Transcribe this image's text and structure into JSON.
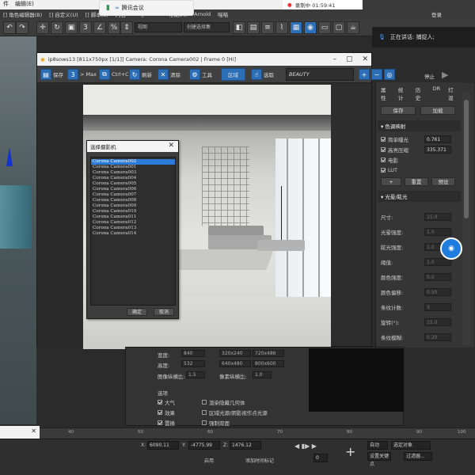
{
  "top_strip": {
    "left_items": [
      "件",
      "编辑(E)"
    ],
    "meeting_label": "腾讯会议",
    "recording_label": "录制中 01:59:41",
    "right_label": "登录"
  },
  "menu": [
    "[] 角色编辑器(B)",
    "[] 自定义(U)",
    "[] 脚本(S)",
    "内容",
    "Megascans",
    "帮助(H)",
    "Arnold",
    "喵喵"
  ],
  "toolbar": {
    "view_select": "视图",
    "selection_set": "创建选择集"
  },
  "speaker": {
    "label": "正在讲话: 捕捉人;"
  },
  "render_window": {
    "title": "ip8sows13 [811x750px [1/1]] Camera: Corona Camera002 | Frame 0 [Hi]",
    "toolbar": {
      "save": "保存",
      "max": "> Max",
      "copy": "Ctrl+C",
      "refresh": "刷新",
      "clear": "清除",
      "tools": "工具",
      "region": "区域",
      "select": "选取",
      "pass": "BEAUTY",
      "stop": "停止"
    },
    "side": {
      "tabs": [
        "属性",
        "统计",
        "历史",
        "DR",
        "灯混"
      ],
      "save_button": "保存",
      "load_button": "加载",
      "tone_section": "色调映射",
      "tone_params": [
        {
          "label": "简单曝光",
          "value": "0.761",
          "checked": true
        },
        {
          "label": "高亮压缩",
          "value": "335.371",
          "checked": true
        },
        {
          "label": "电影",
          "value": "",
          "checked": true
        },
        {
          "label": "LUT",
          "value": "",
          "checked": true
        }
      ],
      "plus": "+",
      "reset_button": "重置",
      "preset_button": "预设",
      "bloom_section": "光晕/眩光",
      "bloom_params": [
        {
          "label": "尺寸:",
          "value": "15.0"
        },
        {
          "label": "光晕强度:",
          "value": "1.0"
        },
        {
          "label": "眩光强度:",
          "value": "1.0"
        },
        {
          "label": "阈值:",
          "value": "1.0"
        },
        {
          "label": "颜色强度:",
          "value": "0.0"
        },
        {
          "label": "颜色偏移:",
          "value": "0.50"
        },
        {
          "label": "条纹计数:",
          "value": "3"
        },
        {
          "label": "旋转(°):",
          "value": "15.0"
        },
        {
          "label": "条纹模糊:",
          "value": "0.20"
        }
      ]
    }
  },
  "camera_dialog": {
    "title": "选择摄影机",
    "close": "✕",
    "cameras": [
      "Corona Camera002",
      "Corona Camera001",
      "Corona Camera003",
      "Corona Camera004",
      "Corona Camera005",
      "Corona Camera006",
      "Corona Camera007",
      "Corona Camera008",
      "Corona Camera009",
      "Corona Camera010",
      "Corona Camera011",
      "Corona Camera012",
      "Corona Camera013",
      "Corona Camera014"
    ],
    "selected_index": 0,
    "ok": "确定",
    "cancel": "取消"
  },
  "render_setup": {
    "width_label": "宽度:",
    "width_value": "840",
    "height_label": "高度:",
    "height_value": "532",
    "presets": [
      "320x240",
      "720x486",
      "640x480",
      "800x600"
    ],
    "aspect_label": "图像纵横比:",
    "aspect_value": "1.5",
    "pixel_aspect_label": "像素纵横比:",
    "pixel_aspect_value": "1.0",
    "options_label": "选项",
    "options": [
      {
        "label": "大气",
        "checked": true
      },
      {
        "label": "效果",
        "checked": true
      },
      {
        "label": "置换",
        "checked": true
      }
    ],
    "options_right": [
      "渲染隐藏几何体",
      "区域光源/阴影视作点光源",
      "强制双面"
    ]
  },
  "timeline": {
    "ticks": [
      "40",
      "50",
      "60",
      "70",
      "80",
      "90",
      "100"
    ]
  },
  "status_bar": {
    "x_label": "X:",
    "x_value": "6090.11",
    "y_label": "Y:",
    "y_value": "-4775.99",
    "z_label": "Z:",
    "z_value": "1476.12",
    "grid_label": "栅格 = 10.0mm",
    "enable_label": "启用",
    "add_marker": "添加时间标记",
    "auto_key": "自动",
    "set_key": "设置关键点",
    "selection": "选定对象",
    "filter": "过滤器...",
    "frame_value": "0"
  }
}
